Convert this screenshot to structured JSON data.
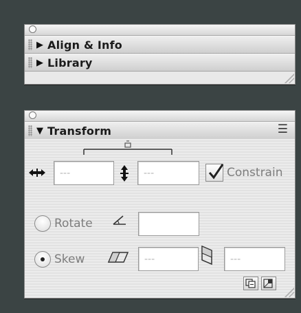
{
  "panels": {
    "top": {
      "items": [
        {
          "label": "Align & Info"
        },
        {
          "label": "Library"
        }
      ]
    },
    "transform": {
      "title": "Transform",
      "width_field": {
        "value": "---"
      },
      "height_field": {
        "value": "---"
      },
      "constrain_label": "Constrain",
      "constrain_checked": true,
      "rotate_label": "Rotate",
      "rotate_field": {
        "value": ""
      },
      "skew_label": "Skew",
      "skew_h_field": {
        "value": "---"
      },
      "skew_v_field": {
        "value": "---"
      },
      "selected_mode": "Skew"
    }
  },
  "icons": {
    "close": "close-circle-icon",
    "grip": "grip-icon",
    "expand": "triangle-right-icon",
    "collapse": "triangle-down-icon",
    "menu": "panel-menu-icon",
    "width": "width-arrows-icon",
    "height": "height-arrows-icon",
    "link": "link-bracket-icon",
    "rotate": "rotate-angle-icon",
    "skew_h": "skew-horizontal-icon",
    "skew_v": "skew-vertical-icon",
    "copy_transform": "copy-and-apply-transform-icon",
    "reset": "reset-transform-icon"
  }
}
